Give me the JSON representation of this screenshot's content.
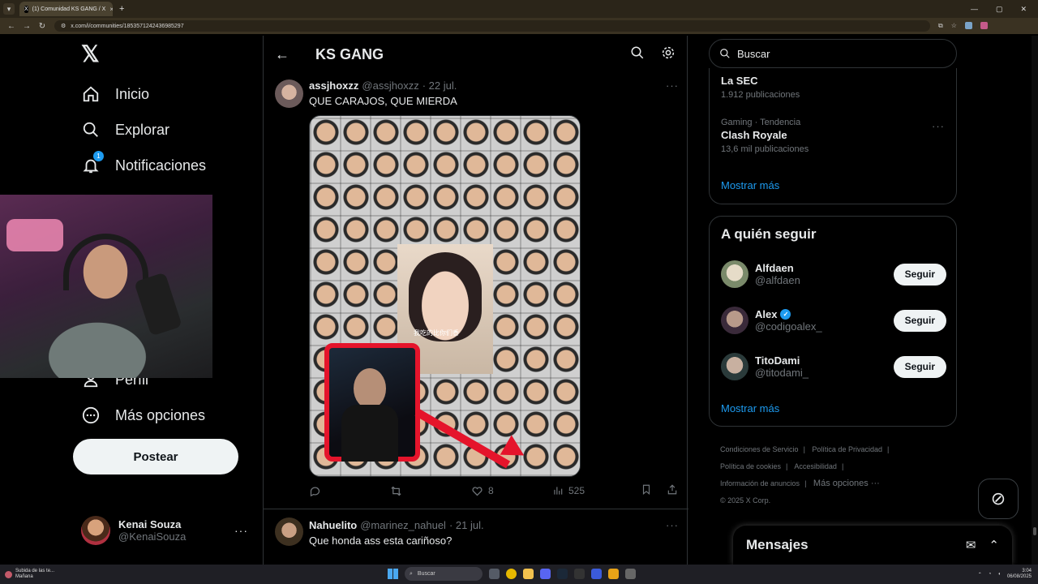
{
  "browser": {
    "tab_title": "(1) Comunidad KS GANG / X",
    "url": "x.com/i/communities/1853571242436985297",
    "new_tab": "+",
    "tab_close": "×"
  },
  "nav": {
    "items": [
      {
        "label": "Inicio"
      },
      {
        "label": "Explorar"
      },
      {
        "label": "Notificaciones",
        "badge": "1"
      },
      {
        "label": "Perfil"
      },
      {
        "label": "Más opciones"
      }
    ],
    "post_button": "Postear",
    "profile": {
      "name": "Kenai Souza",
      "handle": "@KenaiSouza"
    }
  },
  "feed": {
    "title": "KS GANG",
    "tweets": [
      {
        "name": "assjhoxzz",
        "handle": "@assjhoxzz",
        "date": "· 22 jul.",
        "text": "QUE CARAJOS, QUE MIERDA",
        "media_caption": "我吃的比你们香",
        "likes": "8",
        "views": "525"
      },
      {
        "name": "Nahuelito",
        "handle": "@marinez_nahuel",
        "date": "· 21 jul.",
        "text": "Que honda ass esta cariñoso?"
      }
    ]
  },
  "sidebar": {
    "search_placeholder": "Buscar",
    "trends": [
      {
        "meta": "",
        "name": "La SEC",
        "count": "1.912 publicaciones"
      },
      {
        "meta": "Gaming · Tendencia",
        "name": "Clash Royale",
        "count": "13,6 mil publicaciones"
      }
    ],
    "trends_more": "Mostrar más",
    "follow_title": "A quién seguir",
    "follow_users": [
      {
        "name": "Alfdaen",
        "handle": "@alfdaen",
        "button": "Seguir",
        "verified": false
      },
      {
        "name": "Alex",
        "handle": "@codigoalex_",
        "button": "Seguir",
        "verified": true
      },
      {
        "name": "TitoDami",
        "handle": "@titodami_",
        "button": "Seguir",
        "verified": false
      }
    ],
    "follow_more": "Mostrar más",
    "footer": {
      "terms": "Condiciones de Servicio",
      "privacy": "Política de Privacidad",
      "cookies": "Política de cookies",
      "accessibility": "Accesibilidad",
      "ads": "Información de anuncios",
      "more": "Más opciones ···",
      "copyright": "© 2025 X Corp."
    }
  },
  "messages": {
    "title": "Mensajes"
  },
  "taskbar": {
    "weather_line1": "Subida de las te...",
    "weather_line2": "Mañana",
    "search": "Buscar",
    "time": "3:04",
    "date": "06/08/2025"
  },
  "colors": {
    "accent": "#1d9bf0",
    "background": "#000000",
    "red_annotation": "#e5142b"
  }
}
